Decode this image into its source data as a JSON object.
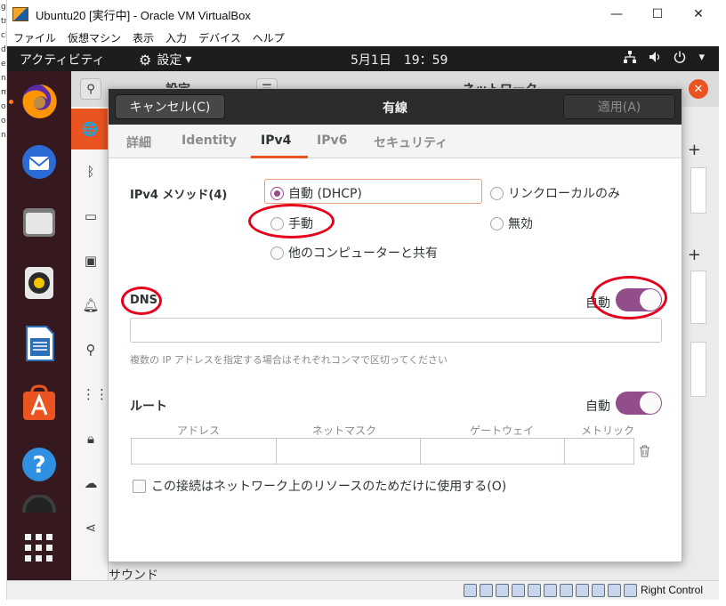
{
  "host_strip": [
    "g",
    "tr",
    "ch",
    "d",
    "e",
    "na",
    "ma",
    "og",
    "om",
    "ne"
  ],
  "window": {
    "title": "Ubuntu20 [実行中] - Oracle VM VirtualBox",
    "minimize": "—",
    "maximize": "☐",
    "close": "✕"
  },
  "menubar": [
    "ファイル",
    "仮想マシン",
    "表示",
    "入力",
    "デバイス",
    "ヘルプ"
  ],
  "topbar": {
    "activities": "アクティビティ",
    "app_menu": "設定",
    "app_menu_arrow": "▾",
    "clock": "5月1日　19：59",
    "menu_arrow": "▾"
  },
  "settings_bg": {
    "header_title": "設定",
    "header_right": "ネットワーク",
    "sound_label": "サウンド"
  },
  "dialog": {
    "cancel": "キャンセル(C)",
    "title": "有線",
    "apply": "適用(A)",
    "tabs": [
      "詳細",
      "Identity",
      "IPv4",
      "IPv6",
      "セキュリティ"
    ],
    "active_tab": "IPv4",
    "ipv4_method_label": "IPv4 メソッド(4)",
    "methods": {
      "dhcp": "自動 (DHCP)",
      "link_local": "リンクローカルのみ",
      "manual": "手動",
      "disabled": "無効",
      "shared": "他のコンピューターと共有"
    },
    "selected_method": "自動 (DHCP)",
    "dns_label": "DNS",
    "dns_auto": "自動",
    "dns_auto_on": true,
    "dns_value": "",
    "dns_hint": "複数の IP アドレスを指定する場合はそれぞれコンマで区切ってください",
    "routes_label": "ルート",
    "routes_auto": "自動",
    "routes_auto_on": true,
    "route_columns": [
      "アドレス",
      "ネットマスク",
      "ゲートウェイ",
      "メトリック"
    ],
    "route_row": [
      "",
      "",
      "",
      ""
    ],
    "only_local_checkbox": "この接続はネットワーク上のリソースのためだけに使用する(O)",
    "only_local_checked": false
  },
  "statusbar": {
    "host_key": "Right Control"
  },
  "colors": {
    "accent_orange": "#e95420",
    "toggle_purple": "#924d8b",
    "annotation_red": "#e5001b",
    "dock": "#36191f"
  }
}
